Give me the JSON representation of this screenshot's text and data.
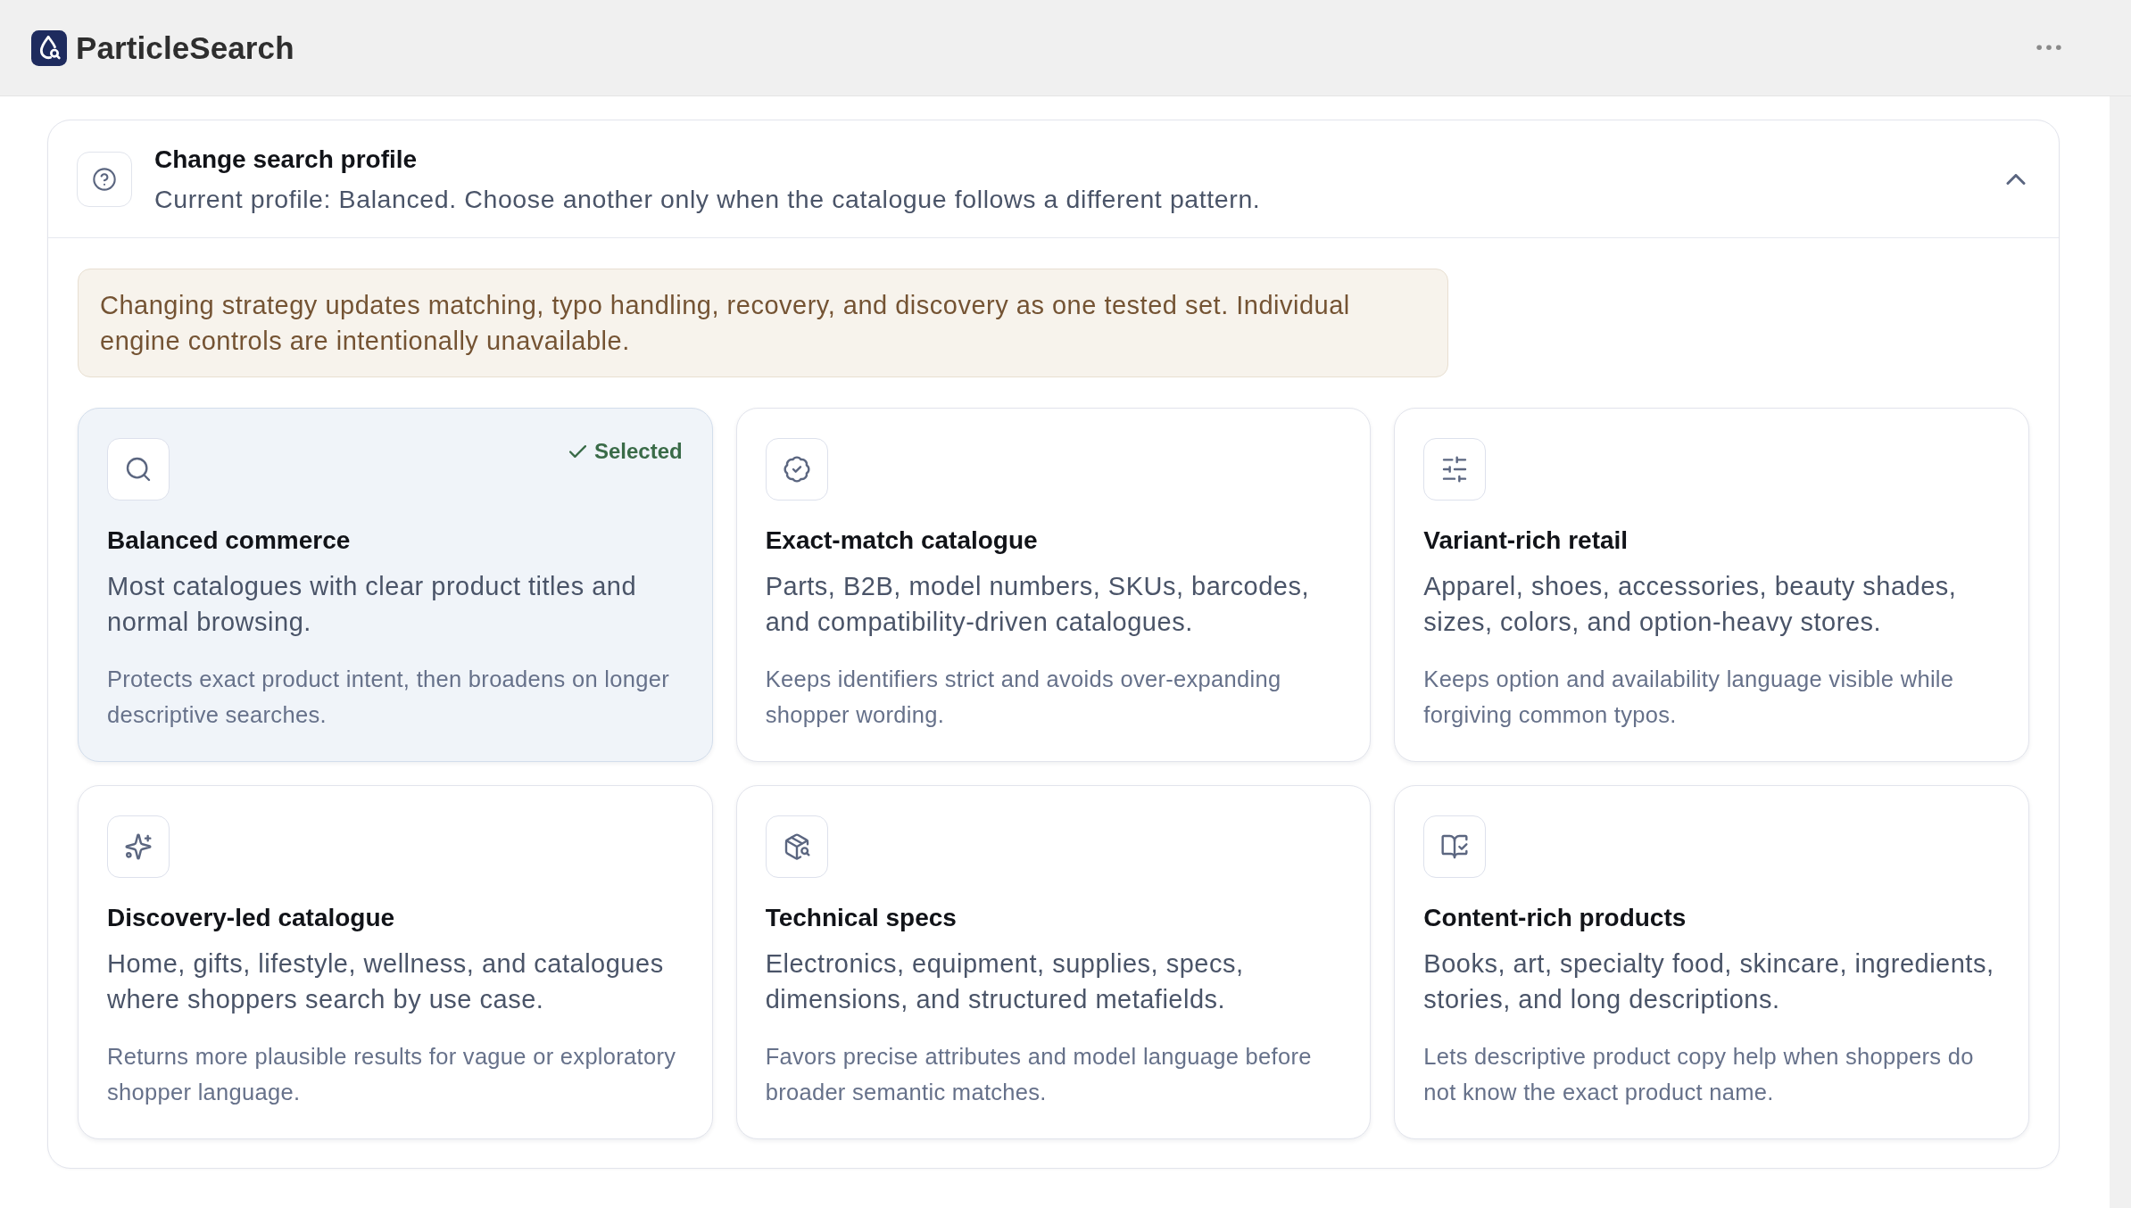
{
  "app": {
    "name": "ParticleSearch"
  },
  "profile_panel": {
    "title": "Change search profile",
    "subtitle": "Current profile: Balanced. Choose another only when the catalogue follows a different pattern.",
    "expanded": true,
    "selected_label": "Selected",
    "notice": "Changing strategy updates matching, typo handling, recovery, and discovery as one tested set. Individual engine controls are intentionally unavailable.",
    "profiles": [
      {
        "title": "Balanced commerce",
        "description": "Most catalogues with clear product titles and normal browsing.",
        "note": "Protects exact product intent, then broadens on longer descriptive searches.",
        "selected": true
      },
      {
        "title": "Exact-match catalogue",
        "description": "Parts, B2B, model numbers, SKUs, barcodes, and compatibility-driven catalogues.",
        "note": "Keeps identifiers strict and avoids over-expanding shopper wording.",
        "selected": false
      },
      {
        "title": "Variant-rich retail",
        "description": "Apparel, shoes, accessories, beauty shades, sizes, colors, and option-heavy stores.",
        "note": "Keeps option and availability language visible while forgiving common typos.",
        "selected": false
      },
      {
        "title": "Discovery-led catalogue",
        "description": "Home, gifts, lifestyle, wellness, and catalogues where shoppers search by use case.",
        "note": "Returns more plausible results for vague or exploratory shopper language.",
        "selected": false
      },
      {
        "title": "Technical specs",
        "description": "Electronics, equipment, supplies, specs, dimensions, and structured metafields.",
        "note": "Favors precise attributes and model language before broader semantic matches.",
        "selected": false
      },
      {
        "title": "Content-rich products",
        "description": "Books, art, specialty food, skincare, ingredients, stories, and long descriptions.",
        "note": "Lets descriptive product copy help when shoppers do not know the exact product name.",
        "selected": false
      }
    ]
  }
}
